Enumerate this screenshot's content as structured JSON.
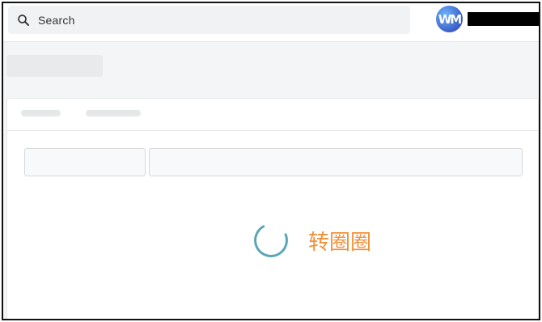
{
  "header": {
    "search": {
      "placeholder": "Search",
      "icon": "search-icon"
    },
    "avatar": {
      "initials": "WM"
    },
    "user_name_redacted": true
  },
  "loading": {
    "text": "转圈圈"
  },
  "colors": {
    "spinner": "#5aa7b3",
    "loading_text": "#f0913a",
    "page_background": "#f4f5f6",
    "skeleton": "#e9eaeb"
  }
}
